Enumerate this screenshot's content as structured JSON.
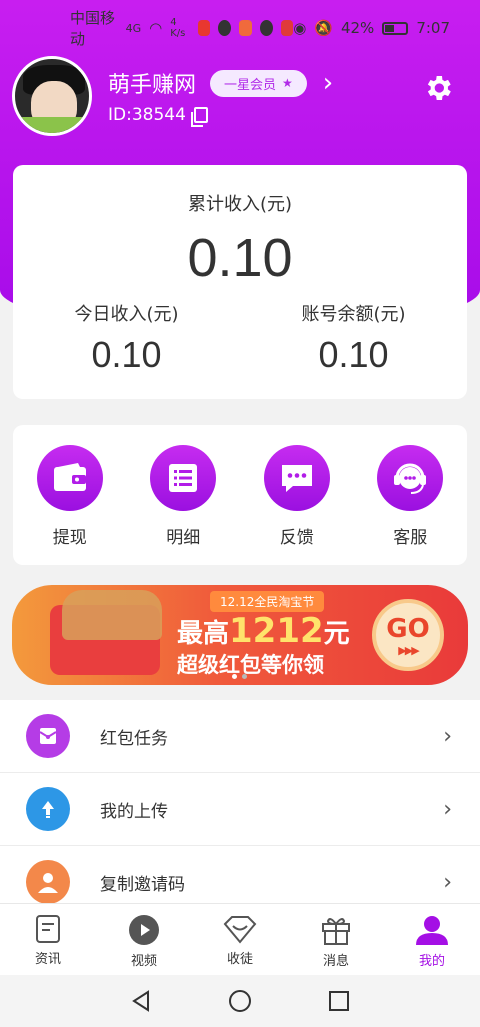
{
  "status_bar": {
    "carrier": "中国移动",
    "signal": "4G",
    "speed": "4 K/s",
    "battery": "42%",
    "time": "7:07"
  },
  "profile": {
    "nickname": "萌手赚网",
    "member_level": "一星会员",
    "user_id": "ID:38544"
  },
  "income": {
    "total_label": "累计收入(元)",
    "total_value": "0.10",
    "today_label": "今日收入(元)",
    "today_value": "0.10",
    "balance_label": "账号余额(元)",
    "balance_value": "0.10"
  },
  "actions": [
    {
      "label": "提现",
      "icon": "wallet-icon"
    },
    {
      "label": "明细",
      "icon": "list-icon"
    },
    {
      "label": "反馈",
      "icon": "chat-icon"
    },
    {
      "label": "客服",
      "icon": "headset-icon"
    }
  ],
  "banner": {
    "tag": "12.12全民淘宝节",
    "line1_prefix": "最高",
    "line1_amount": "1212",
    "line1_suffix": "元",
    "line2": "超级红包等你领",
    "go_label": "GO"
  },
  "menu": [
    {
      "label": "红包任务",
      "icon": "red-envelope-icon",
      "color": "#b53ce6"
    },
    {
      "label": "我的上传",
      "icon": "upload-icon",
      "color": "#2d97e6"
    },
    {
      "label": "复制邀请码",
      "icon": "person-icon",
      "color": "#f3884a"
    }
  ],
  "tabs": [
    {
      "label": "资讯",
      "icon": "document-icon"
    },
    {
      "label": "视频",
      "icon": "play-icon"
    },
    {
      "label": "收徒",
      "icon": "diamond-icon"
    },
    {
      "label": "消息",
      "icon": "gift-icon"
    },
    {
      "label": "我的",
      "icon": "user-icon",
      "active": true
    }
  ],
  "colors": {
    "brand_purple": "#a60be9",
    "active_tab": "#a40fe5"
  }
}
